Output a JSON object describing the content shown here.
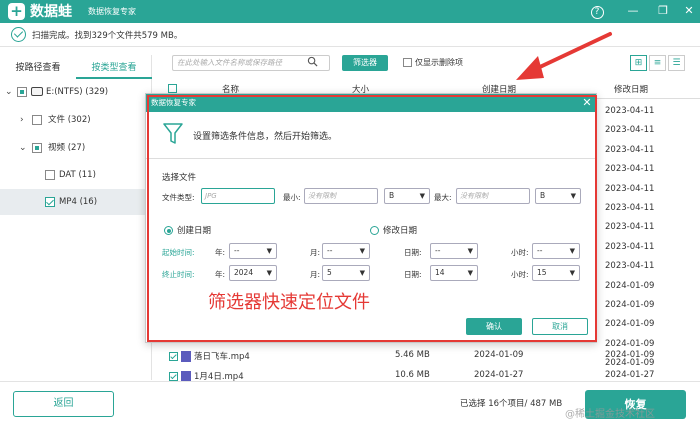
{
  "app": {
    "logo": "+",
    "name": "数据蛙",
    "subtitle": "数据恢复专家"
  },
  "status": {
    "text": "扫描完成。找到329个文件共579 MB。"
  },
  "sidebar": {
    "tabs": [
      {
        "label": "按路径查看"
      },
      {
        "label": "按类型查看"
      }
    ],
    "tree": [
      {
        "label": "E:(NTFS) (329)"
      },
      {
        "label": "文件 (302)"
      },
      {
        "label": "视频 (27)"
      },
      {
        "label": "DAT (11)"
      },
      {
        "label": "MP4 (16)"
      }
    ]
  },
  "toolbar": {
    "search_placeholder": "在此处输入文件名称或保存路径",
    "filter_label": "筛选器",
    "only_deleted_label": "仅显示删除项"
  },
  "table": {
    "headers": [
      "名称",
      "大小",
      "创建日期",
      "修改日期"
    ],
    "background_dates": [
      "2023-04-11",
      "2023-04-11",
      "2023-04-11",
      "2023-04-11",
      "2023-04-11",
      "2023-04-11",
      "2023-04-11",
      "2023-04-11",
      "2023-04-11",
      "2024-01-09",
      "2024-01-09",
      "2024-01-09",
      "2024-01-09",
      "2024-01-09"
    ],
    "rows": [
      {
        "name": "落日飞车.mp4",
        "size": "5.46 MB",
        "created": "2024-01-09",
        "modified": "2024-01-09"
      },
      {
        "name": "1月4日.mp4",
        "size": "10.6 MB",
        "created": "2024-01-27",
        "modified": "2024-01-27"
      }
    ]
  },
  "footer": {
    "back_label": "返回",
    "selection_text": "已选择 16个项目/ 487 MB",
    "recover_label": "恢复"
  },
  "watermark": "@稀土掘金技术社区",
  "dialog": {
    "title": "数据恢复专家",
    "intro": "设置筛选条件信息，然后开始筛选。",
    "section_title": "选择文件",
    "file_type_label": "文件类型:",
    "file_type_placeholder": "JPG",
    "min_label": "最小:",
    "min_placeholder": "没有限制",
    "min_unit": "B",
    "max_label": "最大:",
    "max_placeholder": "没有限制",
    "max_unit": "B",
    "date_created_label": "创建日期",
    "date_modified_label": "修改日期",
    "start_label": "起始时间:",
    "end_label": "终止时间:",
    "year_label": "年:",
    "month_label": "月:",
    "day_label": "日期:",
    "hour_label": "小时:",
    "start": {
      "year": "--",
      "month": "--",
      "day": "--",
      "hour": "--"
    },
    "end": {
      "year": "2024",
      "month": "5",
      "day": "14",
      "hour": "15"
    },
    "confirm_label": "确认",
    "cancel_label": "取消"
  },
  "annotation": "筛选器快速定位文件",
  "colors": {
    "accent": "#2aa596",
    "annotation": "#e53935"
  }
}
